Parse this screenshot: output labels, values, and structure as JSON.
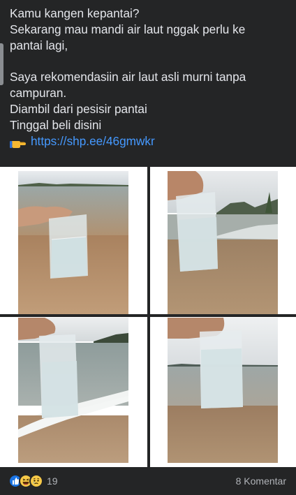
{
  "post": {
    "lines": [
      "Kamu kangen kepantai?",
      "Sekarang mau mandi air laut nggak perlu ke",
      "pantai lagi,",
      "Saya rekomendasiin air laut asli murni tanpa",
      "campuran.",
      "Diambil dari pesisir pantai",
      "Tinggal beli disini"
    ],
    "link_icon": "pointing-hand-emoji",
    "link_text": "https://shp.ee/46gmwkr"
  },
  "photos": [
    {
      "icon": "photo-bag-seawater-beach"
    },
    {
      "icon": "photo-bag-seawater-shore"
    },
    {
      "icon": "photo-bag-seawater-waves"
    },
    {
      "icon": "photo-bag-seawater-horizon"
    }
  ],
  "footer": {
    "reaction_icons": [
      "like-icon",
      "haha-icon",
      "sad-icon"
    ],
    "reaction_count": "19",
    "comments_label": "8 Komentar"
  },
  "colors": {
    "background": "#242526",
    "text": "#e4e6eb",
    "link": "#4599ff",
    "muted": "#b0b3b8"
  }
}
